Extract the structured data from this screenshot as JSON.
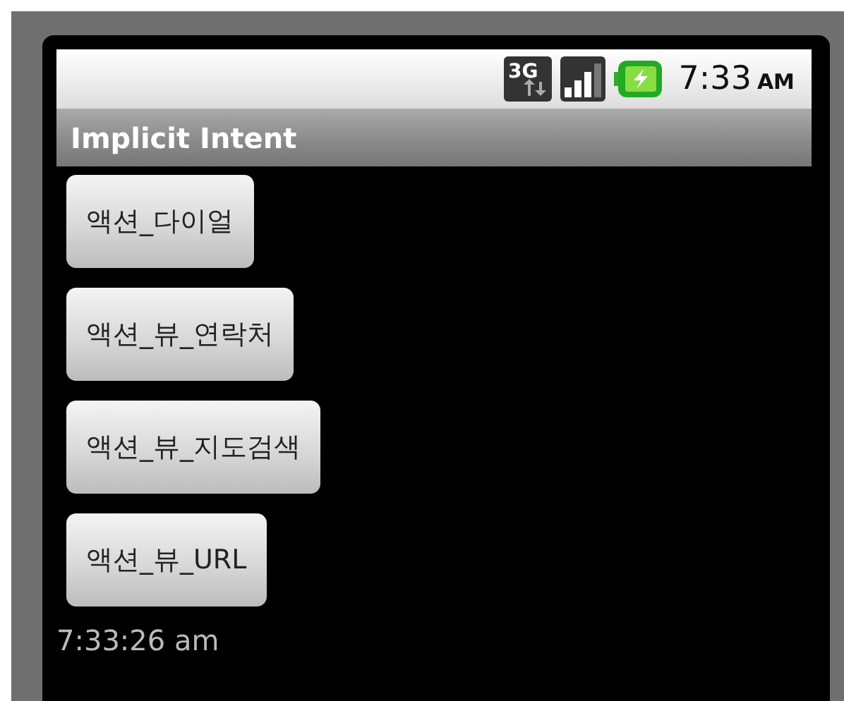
{
  "status_bar": {
    "network_type": "3G",
    "time": "7:33",
    "ampm": "AM"
  },
  "title_bar": {
    "title": "Implicit Intent"
  },
  "buttons": [
    {
      "label": "액션_다이얼"
    },
    {
      "label": "액션_뷰_연락처"
    },
    {
      "label": "액션_뷰_지도검색"
    },
    {
      "label": "액션_뷰_URL"
    }
  ],
  "clock_text": "7:33:26 am"
}
